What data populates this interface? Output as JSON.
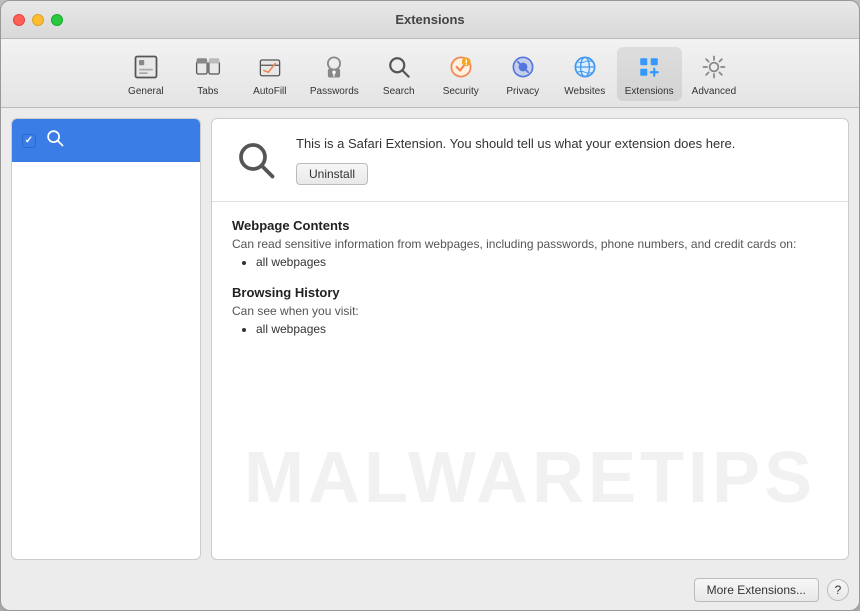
{
  "window": {
    "title": "Extensions"
  },
  "toolbar": {
    "items": [
      {
        "id": "general",
        "label": "General",
        "icon": "general"
      },
      {
        "id": "tabs",
        "label": "Tabs",
        "icon": "tabs"
      },
      {
        "id": "autofill",
        "label": "AutoFill",
        "icon": "autofill"
      },
      {
        "id": "passwords",
        "label": "Passwords",
        "icon": "passwords"
      },
      {
        "id": "search",
        "label": "Search",
        "icon": "search"
      },
      {
        "id": "security",
        "label": "Security",
        "icon": "security"
      },
      {
        "id": "privacy",
        "label": "Privacy",
        "icon": "privacy"
      },
      {
        "id": "websites",
        "label": "Websites",
        "icon": "websites"
      },
      {
        "id": "extensions",
        "label": "Extensions",
        "icon": "extensions",
        "active": true
      },
      {
        "id": "advanced",
        "label": "Advanced",
        "icon": "advanced"
      }
    ]
  },
  "sidebar": {
    "items": [
      {
        "id": "search-ext",
        "label": "",
        "checked": true,
        "active": true
      }
    ]
  },
  "panel": {
    "extension_description": "This is a Safari Extension. You should tell us what your extension does here.",
    "uninstall_label": "Uninstall",
    "permissions": [
      {
        "title": "Webpage Contents",
        "description": "Can read sensitive information from webpages, including passwords, phone numbers, and credit cards on:",
        "items": [
          "all webpages"
        ]
      },
      {
        "title": "Browsing History",
        "description": "Can see when you visit:",
        "items": [
          "all webpages"
        ]
      }
    ]
  },
  "footer": {
    "more_extensions_label": "More Extensions...",
    "help_label": "?"
  },
  "watermark": {
    "text": "MALWARETIPS"
  }
}
